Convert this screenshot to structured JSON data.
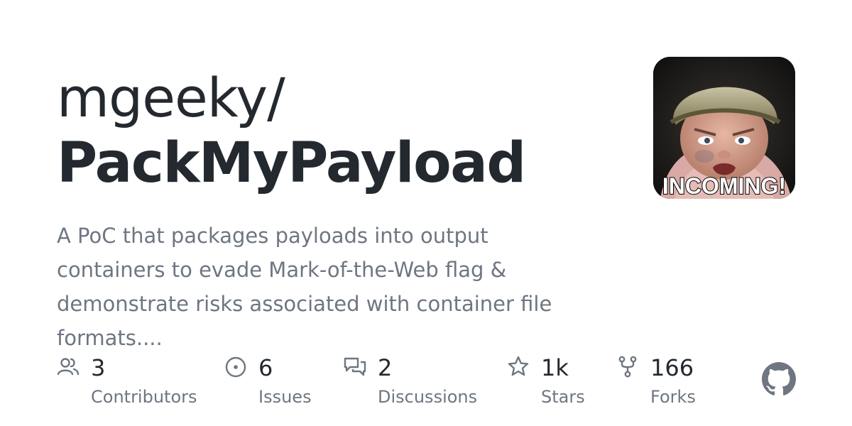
{
  "repo": {
    "owner": "mgeeky/",
    "name": "PackMyPayload",
    "description": "A PoC that packages payloads into output containers to evade Mark-of-the-Web flag & demonstrate risks associated with container file formats....",
    "avatar_caption": "INCOMING!"
  },
  "stats": [
    {
      "icon": "people-icon",
      "value": "3",
      "label": "Contributors"
    },
    {
      "icon": "issue-icon",
      "value": "6",
      "label": "Issues"
    },
    {
      "icon": "discussion-icon",
      "value": "2",
      "label": "Discussions"
    },
    {
      "icon": "star-icon",
      "value": "1k",
      "label": "Stars"
    },
    {
      "icon": "fork-icon",
      "value": "166",
      "label": "Forks"
    }
  ],
  "brand": {
    "icon": "github-icon",
    "color": "#6e7681"
  }
}
